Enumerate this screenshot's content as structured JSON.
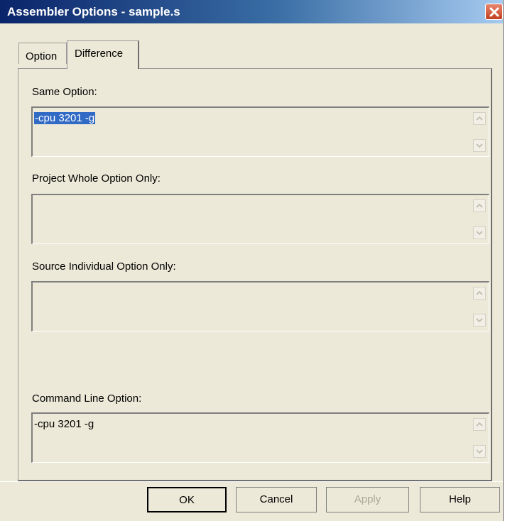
{
  "window": {
    "title": "Assembler Options - sample.s"
  },
  "tabs": [
    {
      "label": "Option",
      "selected": false
    },
    {
      "label": "Difference",
      "selected": true
    }
  ],
  "sections": {
    "same_option": {
      "label": "Same Option:",
      "value": "-cpu 3201 -g",
      "selected": true
    },
    "project_whole": {
      "label": "Project Whole Option Only:",
      "value": ""
    },
    "source_individual": {
      "label": "Source Individual Option Only:",
      "value": ""
    },
    "command_line": {
      "label": "Command Line Option:",
      "value": "-cpu 3201 -g"
    }
  },
  "buttons": {
    "ok": "OK",
    "cancel": "Cancel",
    "apply": "Apply",
    "help": "Help"
  },
  "colors": {
    "dialog_bg": "#ECE9D8",
    "title_gradient_start": "#0a246a",
    "selection": "#316AC5",
    "close_button": "#c2401f"
  }
}
